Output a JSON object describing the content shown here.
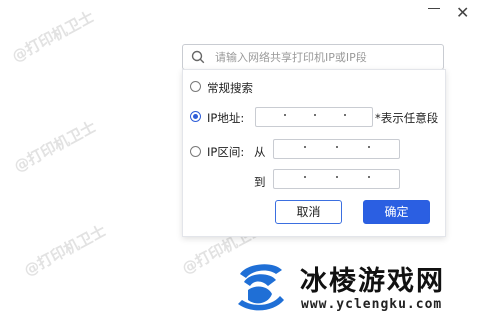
{
  "watermark": "@打印机卫士",
  "search": {
    "placeholder": "请输入网络共享打印机IP或IP段"
  },
  "options": {
    "normal_search": "常规搜索",
    "ip_address": "IP地址:",
    "ip_hint": "*表示任意段",
    "ip_range": "IP区间:",
    "from": "从",
    "to": "到"
  },
  "buttons": {
    "cancel": "取消",
    "confirm": "确定"
  },
  "brand": {
    "name": "冰棱游戏网",
    "url": "www.yclengku.com"
  },
  "colors": {
    "accent": "#2b5fe2",
    "logo_blue": "#1f6fd6"
  }
}
